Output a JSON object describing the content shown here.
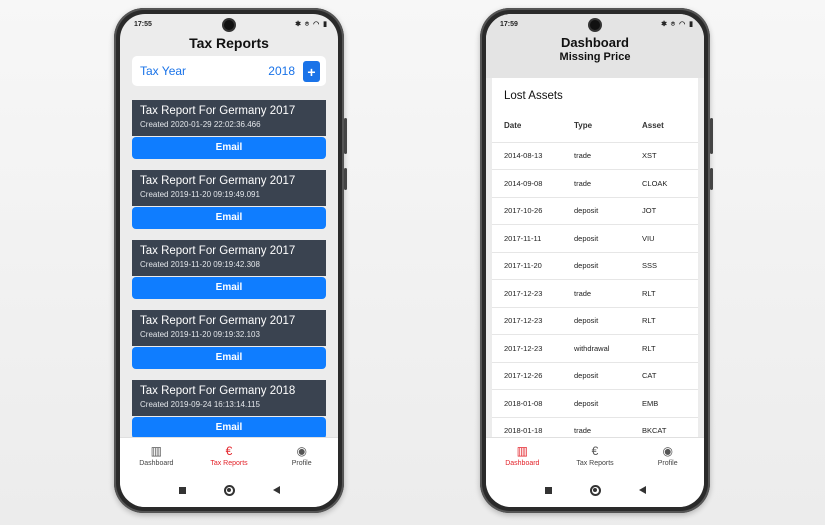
{
  "left": {
    "status": {
      "time": "17:55",
      "icons": "✱ ⌾ ◠ ▮"
    },
    "title": "Tax Reports",
    "year_card": {
      "label": "Tax Year",
      "value": "2018",
      "add_icon": "+"
    },
    "reports": [
      {
        "title": "Tax Report For Germany 2017",
        "created": "Created 2020-01-29 22:02:36.466",
        "button": "Email"
      },
      {
        "title": "Tax Report For Germany 2017",
        "created": "Created 2019-11-20 09:19:49.091",
        "button": "Email"
      },
      {
        "title": "Tax Report For Germany 2017",
        "created": "Created 2019-11-20 09:19:42.308",
        "button": "Email"
      },
      {
        "title": "Tax Report For Germany 2017",
        "created": "Created 2019-11-20 09:19:32.103",
        "button": "Email"
      },
      {
        "title": "Tax Report For Germany 2018",
        "created": "Created 2019-09-24 16:13:14.115",
        "button": "Email"
      }
    ],
    "tabs": [
      {
        "icon": "▥",
        "label": "Dashboard",
        "active": false
      },
      {
        "icon": "€",
        "label": "Tax Reports",
        "active": true
      },
      {
        "icon": "◉",
        "label": "Profile",
        "active": false
      }
    ]
  },
  "right": {
    "status": {
      "time": "17:59",
      "icons": "✱ ⌾ ◠ ▮"
    },
    "title": "Dashboard",
    "subtitle": "Missing Price",
    "card_title": "Lost Assets",
    "columns": [
      "Date",
      "Type",
      "Asset"
    ],
    "rows": [
      [
        "2014-08-13",
        "trade",
        "XST"
      ],
      [
        "2014-09-08",
        "trade",
        "CLOAK"
      ],
      [
        "2017-10-26",
        "deposit",
        "JOT"
      ],
      [
        "2017-11-11",
        "deposit",
        "VIU"
      ],
      [
        "2017-11-20",
        "deposit",
        "SSS"
      ],
      [
        "2017-12-23",
        "trade",
        "RLT"
      ],
      [
        "2017-12-23",
        "deposit",
        "RLT"
      ],
      [
        "2017-12-23",
        "withdrawal",
        "RLT"
      ],
      [
        "2017-12-26",
        "deposit",
        "CAT"
      ],
      [
        "2018-01-08",
        "deposit",
        "EMB"
      ],
      [
        "2018-01-18",
        "trade",
        "BKCAT"
      ]
    ],
    "tabs": [
      {
        "icon": "▥",
        "label": "Dashboard",
        "active": true
      },
      {
        "icon": "€",
        "label": "Tax Reports",
        "active": false
      },
      {
        "icon": "◉",
        "label": "Profile",
        "active": false
      }
    ]
  },
  "colors": {
    "accent": "#0f7dff",
    "active_tab": "#e3232a",
    "report_header": "#3a4350"
  }
}
